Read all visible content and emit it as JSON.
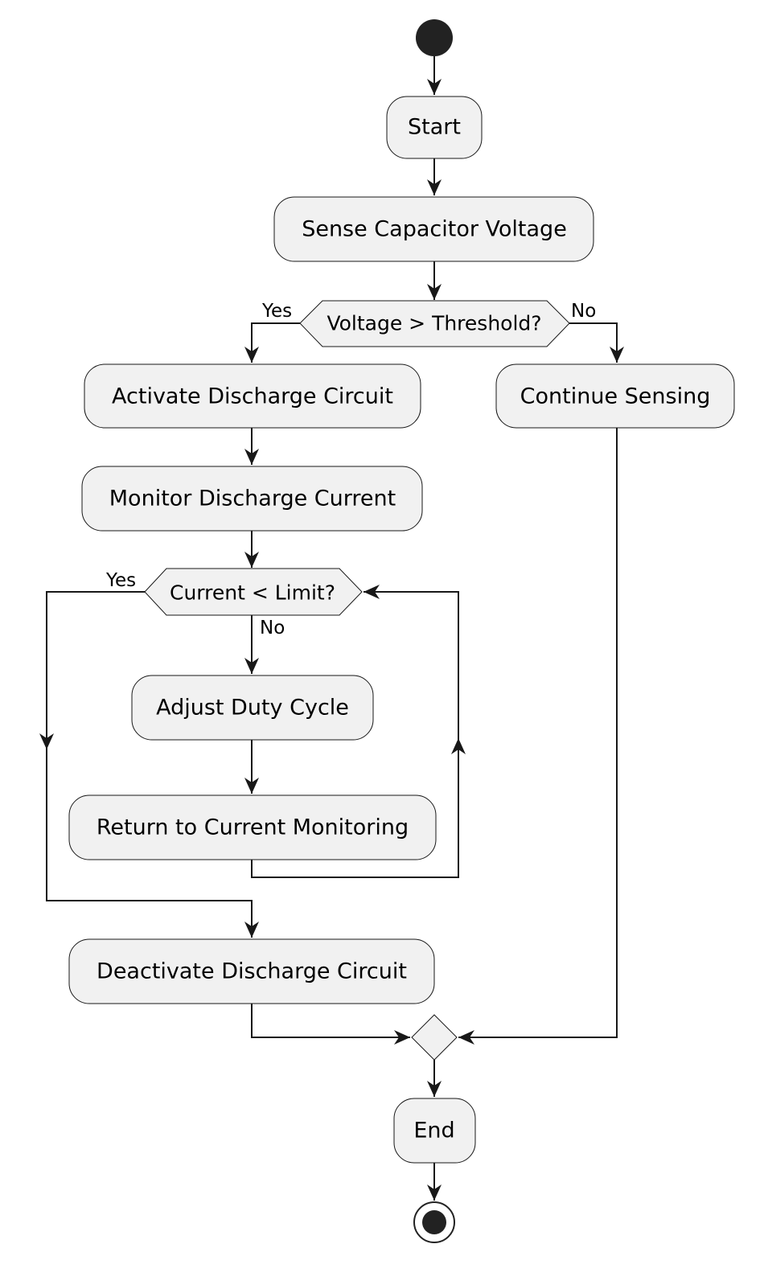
{
  "diagram": {
    "type": "activity",
    "nodes": {
      "start": "Start",
      "sense": "Sense Capacitor Voltage",
      "decision_voltage": "Voltage > Threshold?",
      "activate": "Activate Discharge Circuit",
      "continue": "Continue Sensing",
      "monitor": "Monitor Discharge Current",
      "decision_current": "Current < Limit?",
      "adjust": "Adjust Duty Cycle",
      "return": "Return to Current Monitoring",
      "deactivate": "Deactivate Discharge Circuit",
      "end": "End"
    },
    "labels": {
      "voltage_yes": "Yes",
      "voltage_no": "No",
      "current_yes": "Yes",
      "current_no": "No"
    },
    "colors": {
      "node_fill": "#f1f1f1",
      "stroke": "#181818"
    }
  }
}
